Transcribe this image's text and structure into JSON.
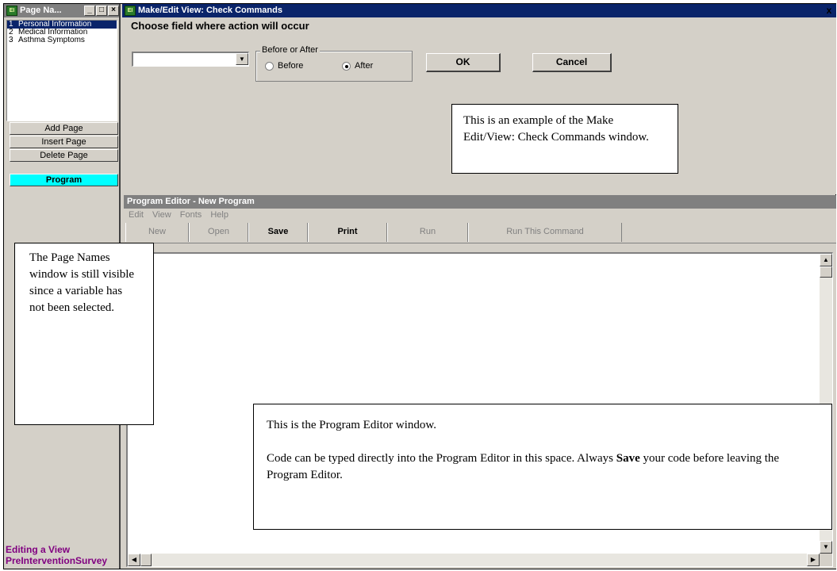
{
  "page_names": {
    "title": "Page Na...",
    "items": [
      {
        "num": "1",
        "label": "Personal Information"
      },
      {
        "num": "2",
        "label": "Medical Information"
      },
      {
        "num": "3",
        "label": "Asthma Symptoms"
      }
    ],
    "add_page": "Add Page",
    "insert_page": "Insert Page",
    "delete_page": "Delete Page",
    "program": "Program",
    "status_line1": "Editing a View",
    "status_line2": "PreInterventionSurvey"
  },
  "make_edit_view": {
    "title": "Make/Edit View: Check Commands",
    "close": "x",
    "choose_label": "Choose field where action will occur",
    "field_value": "",
    "group_label": "Before or After",
    "before_label": "Before",
    "after_label": "After",
    "selected": "After",
    "ok": "OK",
    "cancel": "Cancel"
  },
  "program_editor": {
    "title": "Program Editor - New Program",
    "menu": [
      "Edit",
      "View",
      "Fonts",
      "Help"
    ],
    "toolbar": {
      "new": "New",
      "open": "Open",
      "save": "Save",
      "print": "Print",
      "run": "Run",
      "run_this_command": "Run This Command"
    }
  },
  "callouts": {
    "mev_text": "This is an example of the Make Edit/View: Check Commands window.",
    "page_names_text": "The Page Names window is still visible since a variable has not been selected.",
    "pe_line1": "This is the Program Editor window.",
    "pe_line2_a": "Code can be typed directly into the Program Editor in this space. Always ",
    "pe_line2_bold": "Save",
    "pe_line2_b": " your code before leaving the Program Editor."
  },
  "icons": {
    "app": "app-icon",
    "minimize": "minimize-icon",
    "maximize": "maximize-icon",
    "close": "close-icon",
    "dropdown": "chevron-down-icon"
  }
}
